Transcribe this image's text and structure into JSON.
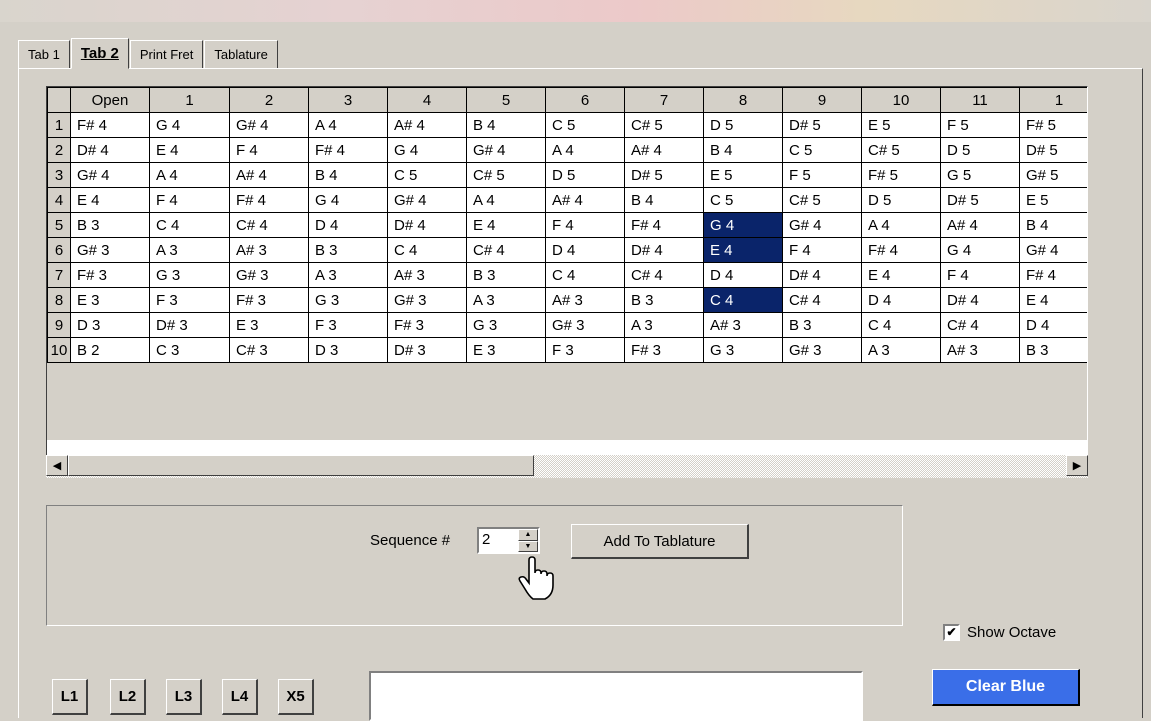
{
  "tabs": [
    "Tab 1",
    "Tab 2",
    "Print Fret",
    "Tablature"
  ],
  "active_tab": 1,
  "grid": {
    "columns": [
      "Open",
      "1",
      "2",
      "3",
      "4",
      "5",
      "6",
      "7",
      "8",
      "9",
      "10",
      "11",
      "1"
    ],
    "rows": [
      {
        "num": "1",
        "cells": [
          "F# 4",
          "G 4",
          "G# 4",
          "A 4",
          "A# 4",
          "B 4",
          "C 5",
          "C# 5",
          "D 5",
          "D# 5",
          "E 5",
          "F 5",
          "F# 5"
        ]
      },
      {
        "num": "2",
        "cells": [
          "D# 4",
          "E 4",
          "F 4",
          "F# 4",
          "G 4",
          "G# 4",
          "A 4",
          "A# 4",
          "B 4",
          "C 5",
          "C# 5",
          "D 5",
          "D# 5"
        ]
      },
      {
        "num": "3",
        "cells": [
          "G# 4",
          "A 4",
          "A# 4",
          "B 4",
          "C 5",
          "C# 5",
          "D 5",
          "D# 5",
          "E 5",
          "F 5",
          "F# 5",
          "G 5",
          "G# 5"
        ]
      },
      {
        "num": "4",
        "cells": [
          "E 4",
          "F 4",
          "F# 4",
          "G 4",
          "G# 4",
          "A 4",
          "A# 4",
          "B 4",
          "C 5",
          "C# 5",
          "D 5",
          "D# 5",
          "E 5"
        ]
      },
      {
        "num": "5",
        "cells": [
          "B 3",
          "C 4",
          "C# 4",
          "D 4",
          "D# 4",
          "E 4",
          "F 4",
          "F# 4",
          "G 4",
          "G# 4",
          "A 4",
          "A# 4",
          "B 4"
        ]
      },
      {
        "num": "6",
        "cells": [
          "G# 3",
          "A 3",
          "A# 3",
          "B 3",
          "C 4",
          "C# 4",
          "D 4",
          "D# 4",
          "E 4",
          "F 4",
          "F# 4",
          "G 4",
          "G# 4"
        ]
      },
      {
        "num": "7",
        "cells": [
          "F# 3",
          "G 3",
          "G# 3",
          "A 3",
          "A# 3",
          "B 3",
          "C 4",
          "C# 4",
          "D 4",
          "D# 4",
          "E 4",
          "F 4",
          "F# 4"
        ]
      },
      {
        "num": "8",
        "cells": [
          "E 3",
          "F 3",
          "F# 3",
          "G 3",
          "G# 3",
          "A 3",
          "A# 3",
          "B 3",
          "C 4",
          "C# 4",
          "D 4",
          "D# 4",
          "E 4"
        ]
      },
      {
        "num": "9",
        "cells": [
          "D 3",
          "D# 3",
          "E 3",
          "F 3",
          "F# 3",
          "G 3",
          "G# 3",
          "A 3",
          "A# 3",
          "B 3",
          "C 4",
          "C# 4",
          "D 4"
        ]
      },
      {
        "num": "10",
        "cells": [
          "B 2",
          "C 3",
          "C# 3",
          "D 3",
          "D# 3",
          "E 3",
          "F 3",
          "F# 3",
          "G 3",
          "G# 3",
          "A 3",
          "A# 3",
          "B 3"
        ]
      }
    ],
    "selected": [
      [
        4,
        8
      ],
      [
        5,
        8
      ],
      [
        7,
        8
      ]
    ],
    "selection_color": "#0a246a"
  },
  "sequence": {
    "label": "Sequence #",
    "value": "2"
  },
  "add_button": "Add To Tablature",
  "show_octave": {
    "label": "Show Octave",
    "checked": true
  },
  "string_buttons": [
    "L1",
    "L2",
    "L3",
    "L4",
    "X5"
  ],
  "clear_button": "Clear Blue",
  "clear_button_color": "#3a6ee8"
}
